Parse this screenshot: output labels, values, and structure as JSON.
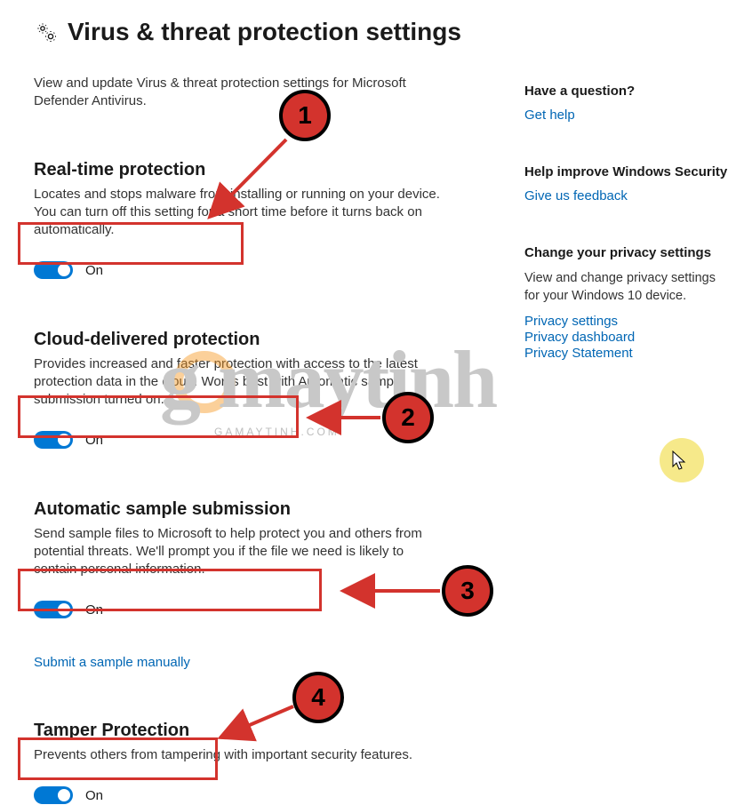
{
  "header": {
    "icon": "gear-pair-icon",
    "title": "Virus & threat protection settings"
  },
  "intro": "View and update Virus & threat protection settings for Microsoft Defender Antivirus.",
  "sections": {
    "realtime": {
      "title": "Real-time protection",
      "desc": "Locates and stops malware from installing or running on your device. You can turn off this setting for a short time before it turns back on automatically.",
      "state_label": "On"
    },
    "cloud": {
      "title": "Cloud-delivered protection",
      "desc": "Provides increased and faster protection with access to the latest protection data in the cloud. Works best with Automatic sample submission turned on.",
      "state_label": "On"
    },
    "sample": {
      "title": "Automatic sample submission",
      "desc": "Send sample files to Microsoft to help protect you and others from potential threats. We'll prompt you if the file we need is likely to contain personal information.",
      "state_label": "On",
      "submit_link": "Submit a sample manually"
    },
    "tamper": {
      "title": "Tamper Protection",
      "desc": "Prevents others from tampering with important security features.",
      "state_label": "On"
    }
  },
  "side": {
    "question": {
      "title": "Have a question?",
      "link": "Get help"
    },
    "improve": {
      "title": "Help improve Windows Security",
      "link": "Give us feedback"
    },
    "privacy": {
      "title": "Change your privacy settings",
      "desc": "View and change privacy settings for your Windows 10 device.",
      "links": [
        "Privacy settings",
        "Privacy dashboard",
        "Privacy Statement"
      ]
    }
  },
  "annotations": {
    "badges": [
      "1",
      "2",
      "3",
      "4"
    ],
    "highlight_color": "#d3332d",
    "watermark_text": "g maytinh",
    "watermark_sub": "GAMAYTINH.COM"
  }
}
